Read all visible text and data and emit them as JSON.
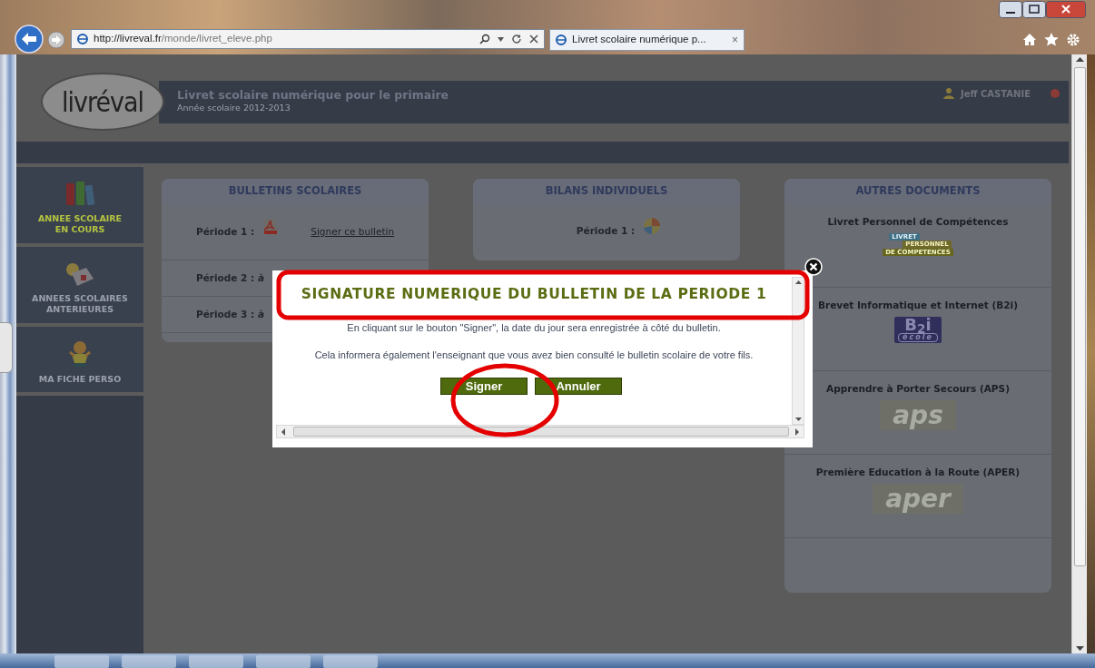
{
  "browser": {
    "url_host": "http://livreval.fr",
    "url_path": "/monde/livret_eleve.php",
    "tab_title": "Livret scolaire numérique p...",
    "tab_close": "×"
  },
  "header": {
    "logo": "livréval",
    "title": "Livret scolaire numérique pour le primaire",
    "subtitle": "Année scolaire 2012-2013",
    "user": "Jeff CASTANIE"
  },
  "sidebar": {
    "items": [
      {
        "kind": "binders",
        "lines": [
          "ANNEE SCOLAIRE",
          "EN COURS"
        ],
        "selected": true
      },
      {
        "kind": "archive",
        "lines": [
          "ANNEES SCOLAIRES",
          "ANTERIEURES"
        ],
        "selected": false
      },
      {
        "kind": "child",
        "lines": [
          "MA FICHE PERSO"
        ],
        "selected": false
      }
    ]
  },
  "cards": [
    {
      "title": "BULLETINS SCOLAIRES",
      "rows": [
        {
          "kind": "period",
          "label": "Période 1 :",
          "link": "Signer ce bulletin"
        },
        {
          "kind": "period",
          "label": "Période 2 : *à*"
        },
        {
          "kind": "period",
          "label": "Période 3 : *à*"
        }
      ]
    },
    {
      "title": "BILANS INDIVIDUELS",
      "rows": [
        {
          "kind": "period",
          "label": "Période 1 :"
        }
      ]
    },
    {
      "title": "AUTRES DOCUMENTS",
      "rows": [
        {
          "kind": "document",
          "label": "Livret Personnel de Compétences",
          "logo": {
            "kind": "lpc",
            "lines": [
              "LIVRET",
              "PERSONNEL",
              "DE COMPETENCES"
            ]
          }
        },
        {
          "kind": "document",
          "label": "Brevet Informatique et Internet (B2i)",
          "logo": {
            "kind": "b2i",
            "text": "B$_{2}$i",
            "sub": "école"
          }
        },
        {
          "kind": "document",
          "label": "Apprendre à Porter Secours (APS)",
          "logo": {
            "kind": "outline",
            "text": "aps"
          }
        },
        {
          "kind": "document",
          "label": "Première Education à la Route (APER)",
          "logo": {
            "kind": "outline",
            "text": "aper"
          }
        }
      ]
    }
  ],
  "modal": {
    "title": "SIGNATURE NUMERIQUE DU BULLETIN DE LA PERIODE 1",
    "paragraphs": [
      "En cliquant sur le bouton \"Signer\", la date du jour sera enregistrée à côté du bulletin.",
      "Cela informera également l'enseignant que vous avez bien consulté le bulletin scolaire de votre fils."
    ],
    "buttons": [
      "Signer",
      "Annuler"
    ]
  },
  "annotations": [
    {
      "kind": "rectangle"
    },
    {
      "kind": "ellipse"
    }
  ]
}
